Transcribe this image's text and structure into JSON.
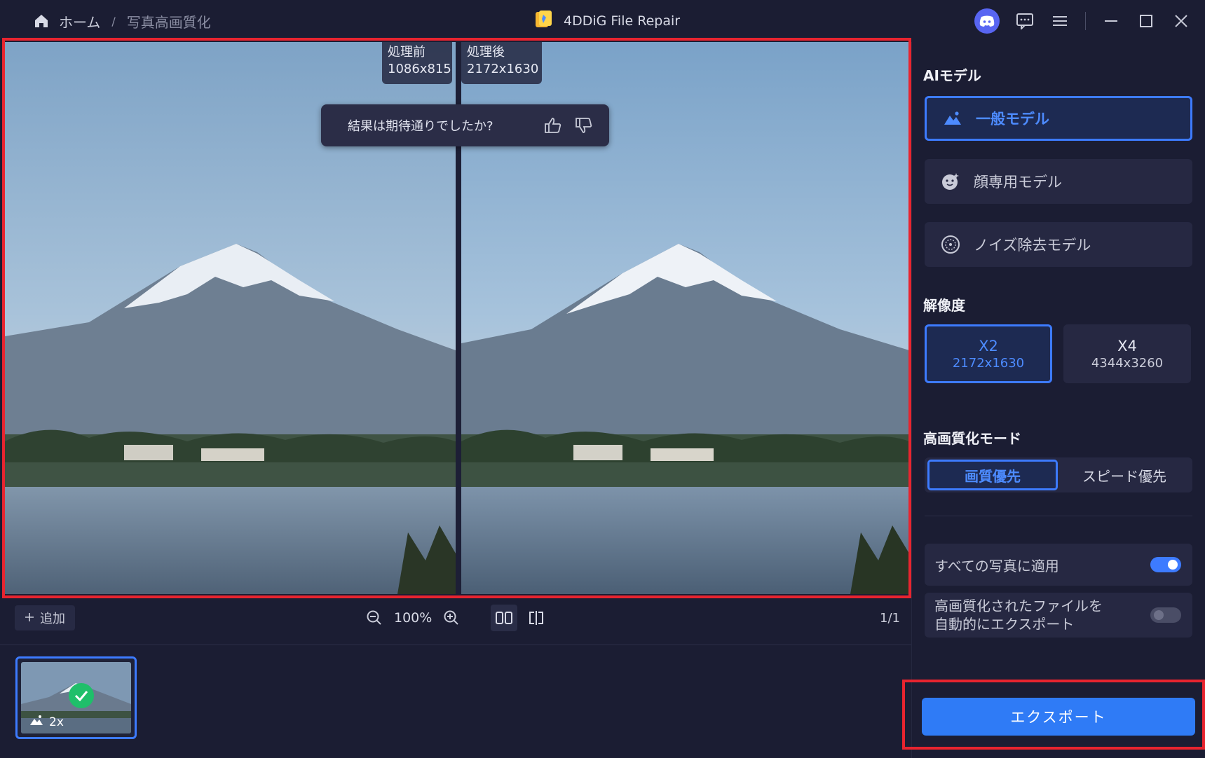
{
  "app": {
    "title": "4DDiG File Repair",
    "icons": [
      "app-logo-icon",
      "discord-icon",
      "chat-icon",
      "menu-icon",
      "minimize-icon",
      "maximize-icon",
      "close-icon"
    ]
  },
  "breadcrumb": {
    "home": "ホーム",
    "separator": "/",
    "current": "写真高画質化"
  },
  "preview": {
    "before_label": "処理前",
    "before_size": "1086x815",
    "after_label": "処理後",
    "after_size": "2172x1630",
    "feedback_question": "結果は期待通りでしたか?"
  },
  "toolbar": {
    "add_label": "追加",
    "zoom_level": "100%",
    "page_count": "1/1"
  },
  "thumbnails": [
    {
      "scale": "2x",
      "status": "done"
    }
  ],
  "panel": {
    "ai_model_title": "AIモデル",
    "models": [
      {
        "label": "一般モデル",
        "active": true,
        "icon": "mountain-icon"
      },
      {
        "label": "顔専用モデル",
        "active": false,
        "icon": "face-icon"
      },
      {
        "label": "ノイズ除去モデル",
        "active": false,
        "icon": "noise-icon"
      }
    ],
    "resolution_title": "解像度",
    "resolutions": [
      {
        "scale": "X2",
        "size": "2172x1630",
        "active": true
      },
      {
        "scale": "X4",
        "size": "4344x3260",
        "active": false
      }
    ],
    "mode_title": "高画質化モード",
    "modes": [
      {
        "label": "画質優先",
        "active": true
      },
      {
        "label": "スピード優先",
        "active": false
      }
    ],
    "apply_all_label": "すべての写真に適用",
    "apply_all_on": true,
    "auto_export_line1": "高画質化されたファイルを",
    "auto_export_line2": "自動的にエクスポート",
    "auto_export_on": false,
    "export_label": "エクスポート"
  },
  "colors": {
    "accent": "#3d7bff",
    "export_button": "#2f7bf6",
    "highlight_frame": "#e8242f",
    "success": "#1fbf6a",
    "background": "#1b1d33"
  }
}
